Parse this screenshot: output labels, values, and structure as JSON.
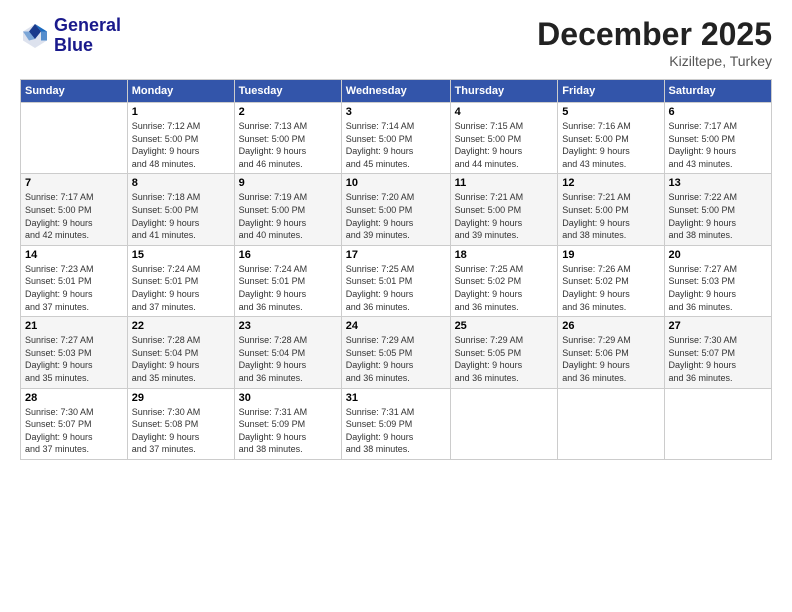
{
  "header": {
    "logo_line1": "General",
    "logo_line2": "Blue",
    "month": "December 2025",
    "location": "Kiziltepe, Turkey"
  },
  "days_of_week": [
    "Sunday",
    "Monday",
    "Tuesday",
    "Wednesday",
    "Thursday",
    "Friday",
    "Saturday"
  ],
  "weeks": [
    [
      {
        "day": "",
        "info": ""
      },
      {
        "day": "1",
        "info": "Sunrise: 7:12 AM\nSunset: 5:00 PM\nDaylight: 9 hours\nand 48 minutes."
      },
      {
        "day": "2",
        "info": "Sunrise: 7:13 AM\nSunset: 5:00 PM\nDaylight: 9 hours\nand 46 minutes."
      },
      {
        "day": "3",
        "info": "Sunrise: 7:14 AM\nSunset: 5:00 PM\nDaylight: 9 hours\nand 45 minutes."
      },
      {
        "day": "4",
        "info": "Sunrise: 7:15 AM\nSunset: 5:00 PM\nDaylight: 9 hours\nand 44 minutes."
      },
      {
        "day": "5",
        "info": "Sunrise: 7:16 AM\nSunset: 5:00 PM\nDaylight: 9 hours\nand 43 minutes."
      },
      {
        "day": "6",
        "info": "Sunrise: 7:17 AM\nSunset: 5:00 PM\nDaylight: 9 hours\nand 43 minutes."
      }
    ],
    [
      {
        "day": "7",
        "info": "Sunrise: 7:17 AM\nSunset: 5:00 PM\nDaylight: 9 hours\nand 42 minutes."
      },
      {
        "day": "8",
        "info": "Sunrise: 7:18 AM\nSunset: 5:00 PM\nDaylight: 9 hours\nand 41 minutes."
      },
      {
        "day": "9",
        "info": "Sunrise: 7:19 AM\nSunset: 5:00 PM\nDaylight: 9 hours\nand 40 minutes."
      },
      {
        "day": "10",
        "info": "Sunrise: 7:20 AM\nSunset: 5:00 PM\nDaylight: 9 hours\nand 39 minutes."
      },
      {
        "day": "11",
        "info": "Sunrise: 7:21 AM\nSunset: 5:00 PM\nDaylight: 9 hours\nand 39 minutes."
      },
      {
        "day": "12",
        "info": "Sunrise: 7:21 AM\nSunset: 5:00 PM\nDaylight: 9 hours\nand 38 minutes."
      },
      {
        "day": "13",
        "info": "Sunrise: 7:22 AM\nSunset: 5:00 PM\nDaylight: 9 hours\nand 38 minutes."
      }
    ],
    [
      {
        "day": "14",
        "info": "Sunrise: 7:23 AM\nSunset: 5:01 PM\nDaylight: 9 hours\nand 37 minutes."
      },
      {
        "day": "15",
        "info": "Sunrise: 7:24 AM\nSunset: 5:01 PM\nDaylight: 9 hours\nand 37 minutes."
      },
      {
        "day": "16",
        "info": "Sunrise: 7:24 AM\nSunset: 5:01 PM\nDaylight: 9 hours\nand 36 minutes."
      },
      {
        "day": "17",
        "info": "Sunrise: 7:25 AM\nSunset: 5:01 PM\nDaylight: 9 hours\nand 36 minutes."
      },
      {
        "day": "18",
        "info": "Sunrise: 7:25 AM\nSunset: 5:02 PM\nDaylight: 9 hours\nand 36 minutes."
      },
      {
        "day": "19",
        "info": "Sunrise: 7:26 AM\nSunset: 5:02 PM\nDaylight: 9 hours\nand 36 minutes."
      },
      {
        "day": "20",
        "info": "Sunrise: 7:27 AM\nSunset: 5:03 PM\nDaylight: 9 hours\nand 36 minutes."
      }
    ],
    [
      {
        "day": "21",
        "info": "Sunrise: 7:27 AM\nSunset: 5:03 PM\nDaylight: 9 hours\nand 35 minutes."
      },
      {
        "day": "22",
        "info": "Sunrise: 7:28 AM\nSunset: 5:04 PM\nDaylight: 9 hours\nand 35 minutes."
      },
      {
        "day": "23",
        "info": "Sunrise: 7:28 AM\nSunset: 5:04 PM\nDaylight: 9 hours\nand 36 minutes."
      },
      {
        "day": "24",
        "info": "Sunrise: 7:29 AM\nSunset: 5:05 PM\nDaylight: 9 hours\nand 36 minutes."
      },
      {
        "day": "25",
        "info": "Sunrise: 7:29 AM\nSunset: 5:05 PM\nDaylight: 9 hours\nand 36 minutes."
      },
      {
        "day": "26",
        "info": "Sunrise: 7:29 AM\nSunset: 5:06 PM\nDaylight: 9 hours\nand 36 minutes."
      },
      {
        "day": "27",
        "info": "Sunrise: 7:30 AM\nSunset: 5:07 PM\nDaylight: 9 hours\nand 36 minutes."
      }
    ],
    [
      {
        "day": "28",
        "info": "Sunrise: 7:30 AM\nSunset: 5:07 PM\nDaylight: 9 hours\nand 37 minutes."
      },
      {
        "day": "29",
        "info": "Sunrise: 7:30 AM\nSunset: 5:08 PM\nDaylight: 9 hours\nand 37 minutes."
      },
      {
        "day": "30",
        "info": "Sunrise: 7:31 AM\nSunset: 5:09 PM\nDaylight: 9 hours\nand 38 minutes."
      },
      {
        "day": "31",
        "info": "Sunrise: 7:31 AM\nSunset: 5:09 PM\nDaylight: 9 hours\nand 38 minutes."
      },
      {
        "day": "",
        "info": ""
      },
      {
        "day": "",
        "info": ""
      },
      {
        "day": "",
        "info": ""
      }
    ]
  ]
}
